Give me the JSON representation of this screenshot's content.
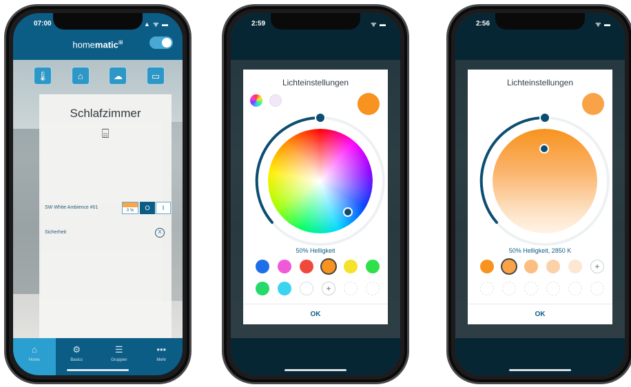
{
  "phone1": {
    "time": "07:00",
    "status_icons": "▲ ᯤ ▬",
    "brand_prefix": "home",
    "brand_bold": "matic",
    "brand_mark": "⊞",
    "categories": [
      "🌡",
      "⌂",
      "☁",
      "▭"
    ],
    "room_name": "Schlafzimmer",
    "bed_icon": "⌸",
    "devices": [
      {
        "name": "SW White Ambience #01",
        "level": "0 %",
        "off": "O",
        "on": "I"
      },
      {
        "name": "Sicherheit",
        "icon": "X"
      }
    ],
    "tabs": [
      {
        "icon": "⌂",
        "label": "Home"
      },
      {
        "icon": "⚙",
        "label": "Basics"
      },
      {
        "icon": "☰",
        "label": "Gruppen"
      },
      {
        "icon": "•••",
        "label": "Mehr"
      }
    ]
  },
  "phone2": {
    "time": "2:59",
    "status_icons": "ᯤ ▬",
    "title": "Lichteinstellungen",
    "hint": "50% Helligkeit",
    "ok": "OK",
    "preview_color": "#f7931e",
    "swatches": [
      "#1e6ee8",
      "#f05ad7",
      "#f0483c",
      "#f7931e",
      "#f6e22a",
      "#2fe04a",
      "#26d96b",
      "#3ad3f0",
      "#ffffff"
    ],
    "plus": "+"
  },
  "phone3": {
    "time": "2:56",
    "status_icons": "ᯤ ▬",
    "title": "Lichteinstellungen",
    "hint": "50% Helligkeit, 2850 K",
    "ok": "OK",
    "preview_color": "#f8a347",
    "swatches": [
      "#f7931e",
      "#f8a347",
      "#fabf80",
      "#fbd2a8",
      "#fde6d2"
    ],
    "plus": "+"
  }
}
